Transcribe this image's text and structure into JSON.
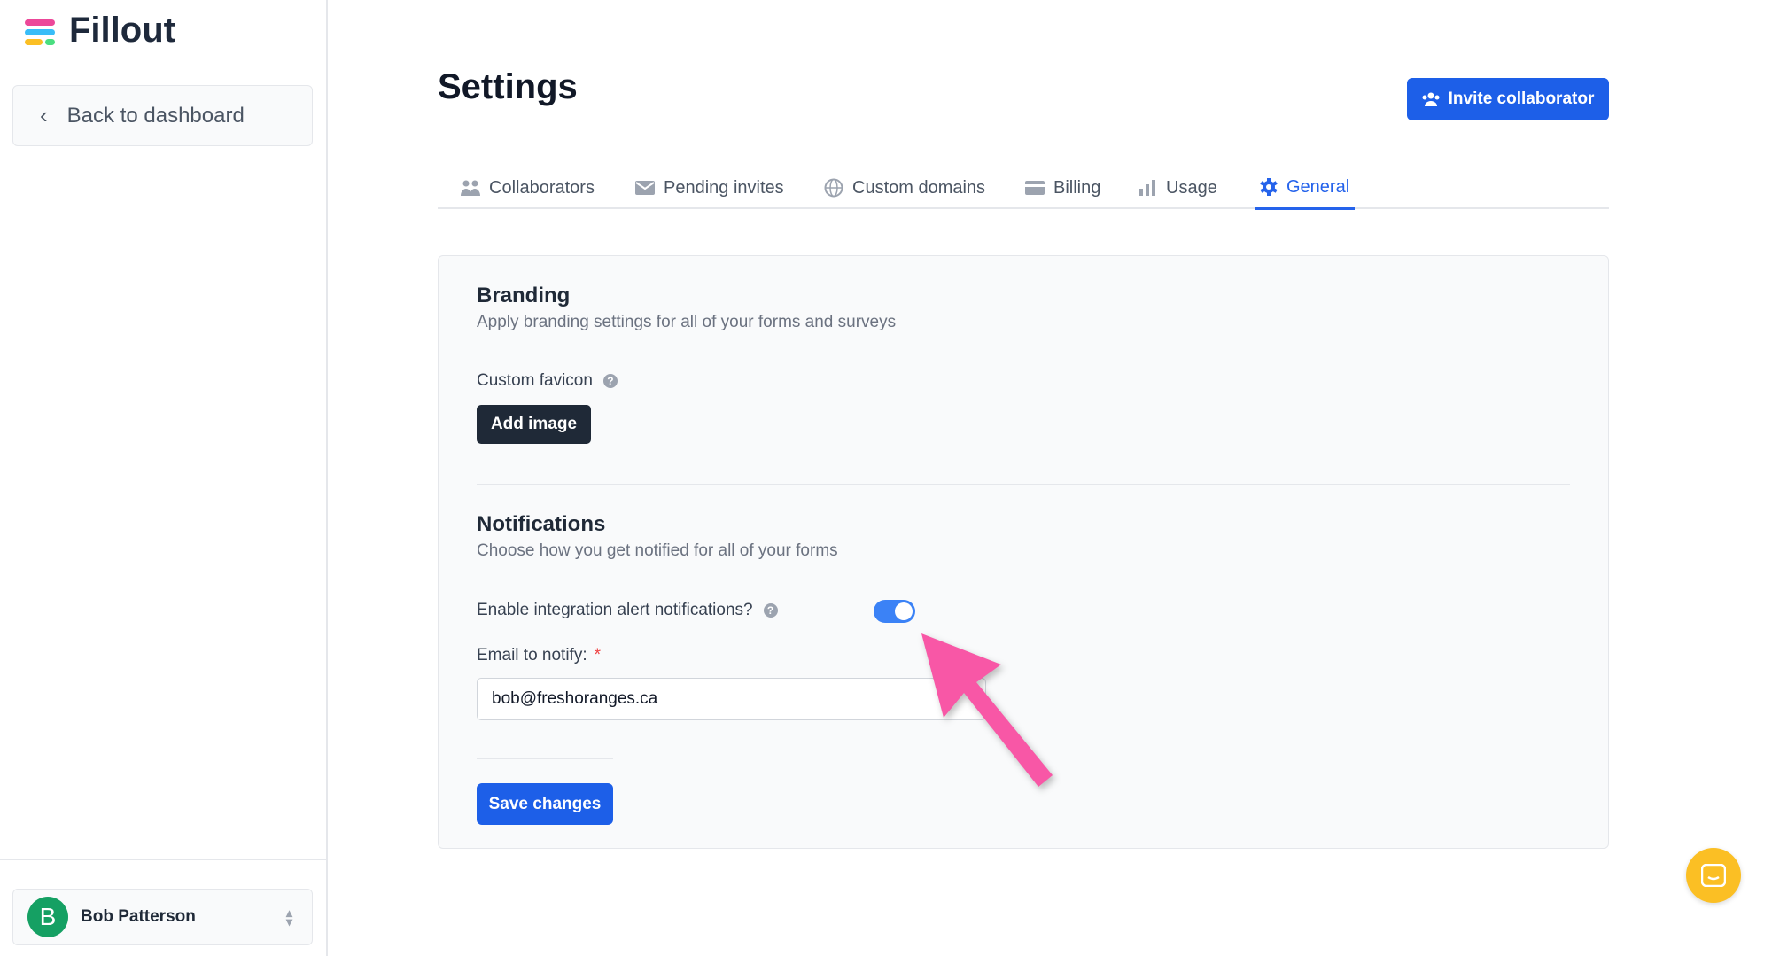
{
  "app": {
    "name": "Fillout"
  },
  "sidebar": {
    "back_label": "Back to dashboard",
    "user": {
      "initial": "B",
      "name": "Bob Patterson"
    }
  },
  "header": {
    "title": "Settings",
    "invite_label": "Invite collaborator"
  },
  "tabs": [
    {
      "label": "Collaborators",
      "icon": "users-icon"
    },
    {
      "label": "Pending invites",
      "icon": "envelope-icon"
    },
    {
      "label": "Custom domains",
      "icon": "globe-icon"
    },
    {
      "label": "Billing",
      "icon": "credit-card-icon"
    },
    {
      "label": "Usage",
      "icon": "bar-chart-icon"
    },
    {
      "label": "General",
      "icon": "gear-icon",
      "active": true
    }
  ],
  "branding": {
    "title": "Branding",
    "description": "Apply branding settings for all of your forms and surveys",
    "favicon_label": "Custom favicon",
    "add_image_label": "Add image"
  },
  "notifications": {
    "title": "Notifications",
    "description": "Choose how you get notified for all of your forms",
    "toggle_label": "Enable integration alert notifications?",
    "toggle_on": true,
    "email_label": "Email to notify:",
    "required_mark": "*",
    "email_value": "bob@freshoranges.ca"
  },
  "save_label": "Save changes",
  "colors": {
    "accent": "#1d5fe8",
    "annotation_arrow": "#f857a6",
    "chat": "#fbbf24"
  }
}
